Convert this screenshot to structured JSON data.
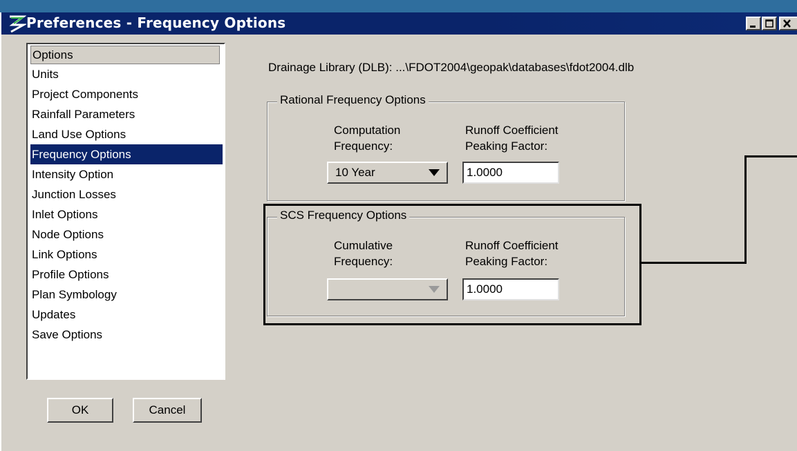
{
  "window": {
    "title": "Preferences - Frequency Options",
    "app_icon": "geopak-logo-icon",
    "controls": [
      "minimize-icon",
      "maximize-icon",
      "close-icon"
    ]
  },
  "sidebar": {
    "header": "Options",
    "items": [
      {
        "label": "Units"
      },
      {
        "label": "Project Components"
      },
      {
        "label": "Rainfall Parameters"
      },
      {
        "label": "Land Use Options"
      },
      {
        "label": "Frequency Options",
        "selected": true
      },
      {
        "label": "Intensity Option"
      },
      {
        "label": "Junction Losses"
      },
      {
        "label": "Inlet Options"
      },
      {
        "label": "Node Options"
      },
      {
        "label": "Link Options"
      },
      {
        "label": "Profile Options"
      },
      {
        "label": "Plan Symbology"
      },
      {
        "label": "Updates"
      },
      {
        "label": "Save Options"
      }
    ]
  },
  "buttons": {
    "ok": "OK",
    "cancel": "Cancel"
  },
  "main": {
    "dlb_label": "Drainage Library (DLB): ...\\FDOT2004\\geopak\\databases\\fdot2004.dlb",
    "rational": {
      "title": "Rational Frequency Options",
      "freq_label_1": "Computation",
      "freq_label_2": "Frequency:",
      "coef_label_1": "Runoff Coefficient",
      "coef_label_2": "Peaking Factor:",
      "freq_value": "10 Year",
      "coef_value": "1.0000"
    },
    "scs": {
      "title": "SCS Frequency Options",
      "freq_label_1": "Cumulative",
      "freq_label_2": "Frequency:",
      "coef_label_1": "Runoff Coefficient",
      "coef_label_2": "Peaking Factor:",
      "freq_value": "",
      "freq_disabled": true,
      "coef_value": "1.0000"
    }
  },
  "colors": {
    "titlebar": "#0a246a",
    "dialog_bg": "#d4d0c8",
    "desktop_bg": "#2f6e9e",
    "selection": "#0a246a"
  }
}
